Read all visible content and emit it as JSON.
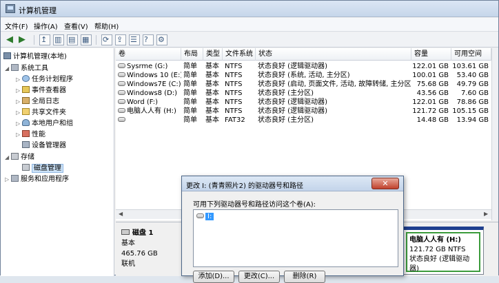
{
  "window": {
    "title": "计算机管理"
  },
  "menu": [
    {
      "label": "文件(F)"
    },
    {
      "label": "操作(A)"
    },
    {
      "label": "查看(V)"
    },
    {
      "label": "帮助(H)"
    }
  ],
  "toolbar": {
    "icons": [
      "back-arrow-icon",
      "forward-arrow-icon",
      "up-folder-icon",
      "show-hide-tree-icon",
      "console-icon",
      "details-icon",
      "refresh-icon",
      "export-list-icon",
      "properties-icon",
      "help-icon",
      "action-icon"
    ]
  },
  "tree": {
    "root": "计算机管理(本地)",
    "system_tools": "系统工具",
    "task_scheduler": "任务计划程序",
    "event_viewer": "事件查看器",
    "shared_folders_log": "全局日志",
    "shared_folders": "共享文件夹",
    "local_users": "本地用户和组",
    "performance": "性能",
    "device_manager": "设备管理器",
    "storage": "存储",
    "disk_management": "磁盘管理",
    "services": "服务和应用程序"
  },
  "volume_list": {
    "columns": [
      "卷",
      "布局",
      "类型",
      "文件系统",
      "状态",
      "容量",
      "可用空间"
    ],
    "rows": [
      {
        "volume": "Sysrme (G:)",
        "layout": "简单",
        "type": "基本",
        "fs": "NTFS",
        "status": "状态良好 (逻辑驱动器)",
        "capacity": "122.01 GB",
        "free": "103.61 GB"
      },
      {
        "volume": "Windows 10 (E:)",
        "layout": "简单",
        "type": "基本",
        "fs": "NTFS",
        "status": "状态良好 (系统, 活动, 主分区)",
        "capacity": "100.01 GB",
        "free": "53.40 GB"
      },
      {
        "volume": "Windows7E (C:)",
        "layout": "简单",
        "type": "基本",
        "fs": "NTFS",
        "status": "状态良好 (启动, 页面文件, 活动, 故障转储, 主分区)",
        "capacity": "75.68 GB",
        "free": "49.79 GB"
      },
      {
        "volume": "Windows8 (D:)",
        "layout": "简单",
        "type": "基本",
        "fs": "NTFS",
        "status": "状态良好 (主分区)",
        "capacity": "43.56 GB",
        "free": "7.60 GB"
      },
      {
        "volume": "Word (F:)",
        "layout": "简单",
        "type": "基本",
        "fs": "NTFS",
        "status": "状态良好 (逻辑驱动器)",
        "capacity": "122.01 GB",
        "free": "78.86 GB"
      },
      {
        "volume": "电脑人人有 (H:)",
        "layout": "简单",
        "type": "基本",
        "fs": "NTFS",
        "status": "状态良好 (逻辑驱动器)",
        "capacity": "121.72 GB",
        "free": "105.15 GB"
      },
      {
        "volume": "",
        "layout": "简单",
        "type": "基本",
        "fs": "FAT32",
        "status": "状态良好 (主分区)",
        "capacity": "14.48 GB",
        "free": "13.94 GB"
      }
    ]
  },
  "disk_panel": {
    "name": "磁盘 1",
    "type": "基本",
    "size": "465.76 GB",
    "state": "联机",
    "partition": {
      "name": "电脑人人有 (H:)",
      "size_fs": "121.72 GB NTFS",
      "status": "状态良好 (逻辑驱动器)"
    }
  },
  "dialog": {
    "title": "更改 I: (青青照片2) 的驱动器号和路径",
    "close": "✕",
    "prompt": "可用下列驱动器号和路径访问这个卷(A):",
    "item": "I:",
    "buttons": {
      "add": "添加(D)...",
      "change": "更改(C)...",
      "delete": "删除(R)"
    }
  }
}
